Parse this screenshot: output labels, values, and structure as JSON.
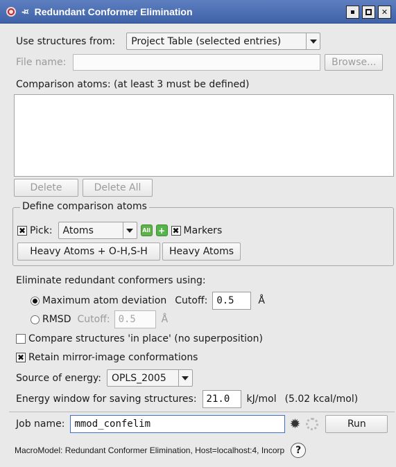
{
  "window": {
    "title": "Redundant Conformer Elimination",
    "pin_glyph": "-¤"
  },
  "source": {
    "label": "Use structures from:",
    "selected": "Project Table (selected entries)"
  },
  "file": {
    "label": "File name:",
    "value": "",
    "browse_label": "Browse..."
  },
  "comparison": {
    "label": "Comparison atoms:  (at least 3 must be defined)",
    "delete_label": "Delete",
    "delete_all_label": "Delete All"
  },
  "define_group": {
    "legend": "Define comparison atoms",
    "pick_label": "Pick:",
    "pick_checked": true,
    "pick_selected": "Atoms",
    "all_icon_text": "All",
    "markers_label": "Markers",
    "markers_checked": true,
    "heavy_oh_label": "Heavy Atoms + O-H,S-H",
    "heavy_label": "Heavy Atoms"
  },
  "eliminate": {
    "label": "Eliminate redundant conformers using:",
    "max_dev_label": "Maximum atom deviation",
    "max_dev_selected": true,
    "cutoff_label": "Cutoff:",
    "max_dev_cutoff": "0.5",
    "angstrom": "Å",
    "rmsd_label": "RMSD",
    "rmsd_selected": false,
    "rmsd_cutoff": "0.5"
  },
  "options": {
    "in_place_label": "Compare structures 'in place' (no superposition)",
    "in_place_checked": false,
    "mirror_label": "Retain mirror-image conformations",
    "mirror_checked": true
  },
  "energy": {
    "source_label": "Source of energy:",
    "source_selected": "OPLS_2005",
    "window_label": "Energy window for saving structures:",
    "window_value": "21.0",
    "unit": "kJ/mol",
    "kcal_text": "(5.02 kcal/mol)"
  },
  "job": {
    "label": "Job name:",
    "value": "mmod_confelim",
    "run_label": "Run"
  },
  "status": {
    "text": "MacroModel: Redundant Conformer Elimination, Host=localhost:4, Incorp",
    "help_label": "?"
  }
}
